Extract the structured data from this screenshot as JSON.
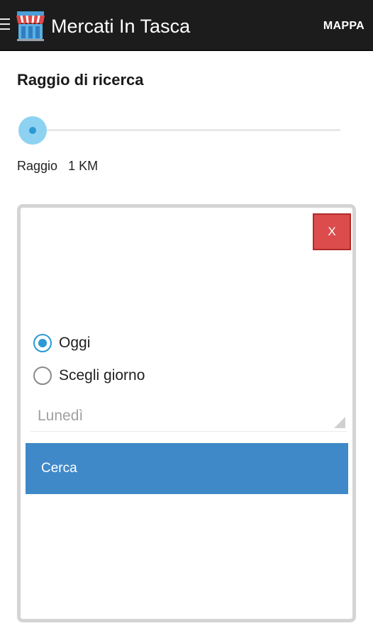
{
  "app_bar": {
    "title": "Mercati In Tasca",
    "map_button": "MAPPA",
    "menu_icon": "hamburger-icon",
    "logo_icon": "market-stall-icon"
  },
  "radius": {
    "title": "Raggio di ricerca",
    "label": "Raggio",
    "value": "1 KM",
    "slider_level": 0
  },
  "panel": {
    "close_label": "X",
    "options": [
      {
        "label": "Oggi",
        "checked": true
      },
      {
        "label": "Scegli giorno",
        "checked": false
      }
    ],
    "day_select": {
      "value": "Lunedì"
    },
    "search_button": "Cerca"
  },
  "colors": {
    "action_bar": "#1c1c1c",
    "accent": "#2b99d4",
    "close_button": "#dc4c4c",
    "search_button": "#3f89c9"
  }
}
